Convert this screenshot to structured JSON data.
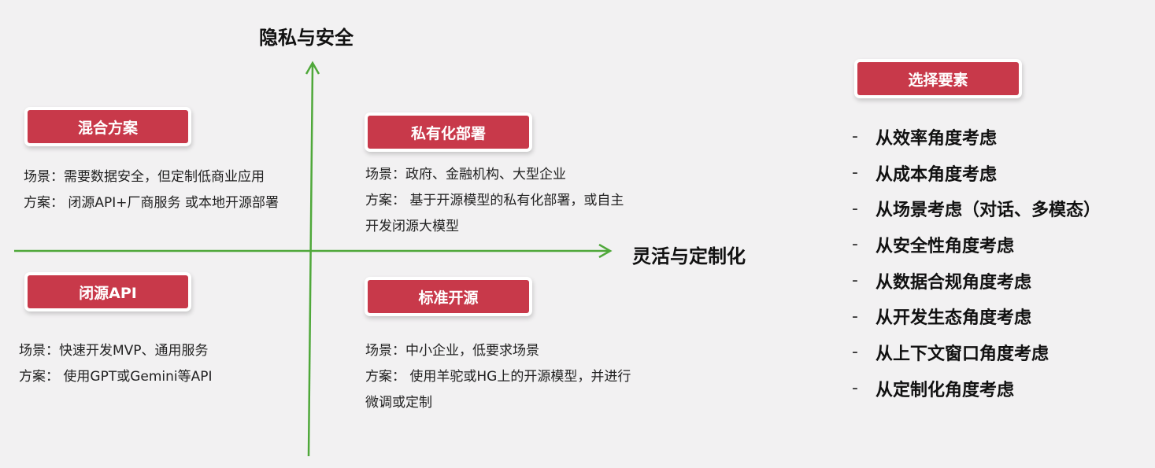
{
  "axes": {
    "y_title": "隐私与安全",
    "x_title": "灵活与定制化",
    "color": "#4fa83a"
  },
  "accent_color": "#c8394a",
  "quadrants": [
    {
      "title": "混合方案",
      "scene": "场景：需要数据安全，但定制低商业应用",
      "solution": "方案：  闭源API+厂商服务 或本地开源部署",
      "extra": ""
    },
    {
      "title": "私有化部署",
      "scene": "场景：政府、金融机构、大型企业",
      "solution": "方案：  基于开源模型的私有化部署，或自主",
      "extra": "开发闭源大模型"
    },
    {
      "title": "闭源API",
      "scene": "场景：快速开发MVP、通用服务",
      "solution": "方案：  使用GPT或Gemini等API",
      "extra": ""
    },
    {
      "title": "标准开源",
      "scene": "场景：中小企业，低要求场景",
      "solution": "方案：  使用羊驼或HG上的开源模型，并进行",
      "extra": "微调或定制"
    }
  ],
  "factors": {
    "title": "选择要素",
    "bullet": "-",
    "items": [
      "从效率角度考虑",
      "从成本角度考虑",
      "从场景考虑（对话、多模态）",
      "从安全性角度考虑",
      "从数据合规角度考虑",
      "从开发生态角度考虑",
      "从上下文窗口角度考虑",
      "从定制化角度考虑"
    ]
  }
}
